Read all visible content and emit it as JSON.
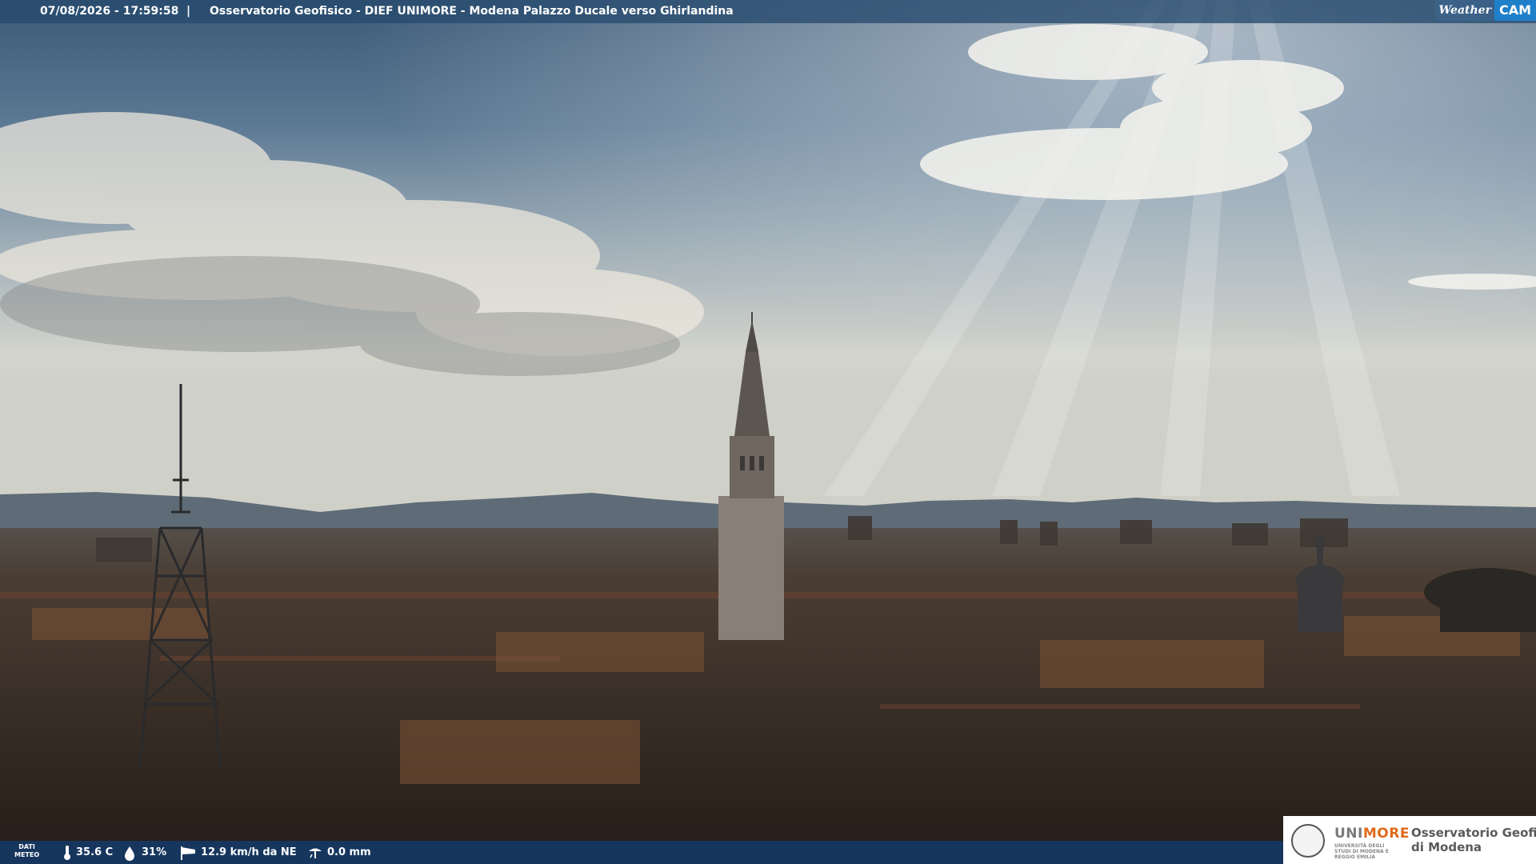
{
  "overlay": {
    "timestamp": "07/08/2026 - 17:59:58",
    "separator": "|",
    "title": "Osservatorio Geofisico - DIEF UNIMORE - Modena Palazzo Ducale verso Ghirlandina",
    "brand_weather": "Weather",
    "brand_cam": "CAM"
  },
  "weather": {
    "label_line1": "DATI",
    "label_line2": "METEO",
    "temperature": "35.6 C",
    "humidity": "31%",
    "wind": "12.9 km/h da NE",
    "rain": "0.0 mm",
    "icons": [
      "thermometer-icon",
      "humidity-drop-icon",
      "wind-sock-icon",
      "rain-gauge-icon"
    ]
  },
  "logo": {
    "uni_prefix": "UNI",
    "uni_suffix": "MORE",
    "uni_subtitle": "UNIVERSITÀ DEGLI STUDI DI MODENA E REGGIO EMILIA",
    "org_line1": "Osservatorio Geofisico",
    "org_line2": "di Modena"
  },
  "colors": {
    "sky_top": "#3c5a78",
    "sky_horizon": "#d8d7cc",
    "mountains": "#6c7a86",
    "city": "#3a2e26",
    "overlay_bar": "#264a6e",
    "brand_blue": "#1f7fc8",
    "unimore_orange": "#e06a1b"
  }
}
